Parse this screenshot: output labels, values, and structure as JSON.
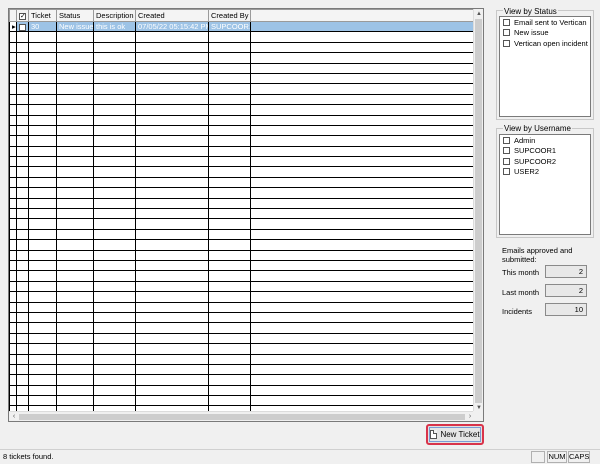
{
  "grid": {
    "columns": [
      "Ticket",
      "Status",
      "Description",
      "Created",
      "Created By"
    ],
    "rows": [
      {
        "ticket": "30",
        "status": "New issue",
        "description": "this is ok",
        "created": "07/05/22 05:15:42 PM",
        "created_by": "SUPCOOR1"
      }
    ],
    "empty_row_count": 37
  },
  "right_panel": {
    "status_group": {
      "label": "View by Status",
      "items": [
        "Email sent to Vertican",
        "New issue",
        "Vertican open incident"
      ]
    },
    "username_group": {
      "label": "View by Username",
      "items": [
        "Admin",
        "SUPCOOR1",
        "SUPCOOR2",
        "USER2"
      ]
    },
    "stats": {
      "heading": "Emails approved and submitted:",
      "this_month_label": "This month",
      "this_month_value": "2",
      "last_month_label": "Last month",
      "last_month_value": "2",
      "incidents_label": "Incidents",
      "incidents_value": "10"
    }
  },
  "toolbar": {
    "new_ticket_label": "New Ticket"
  },
  "statusbar": {
    "message": "8 tickets found.",
    "num": "NUM",
    "caps": "CAPS"
  }
}
